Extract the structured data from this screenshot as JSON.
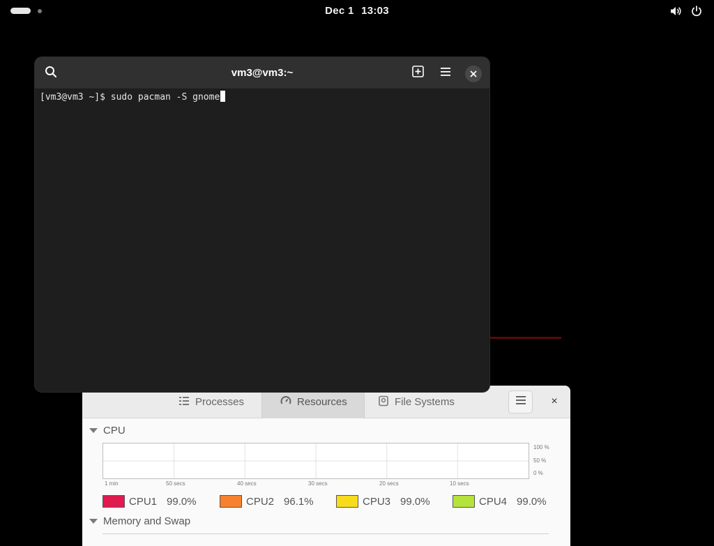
{
  "topbar": {
    "date": "Dec 1",
    "time": "13:03",
    "icons": [
      "activities-indicator",
      "volume-icon",
      "power-icon"
    ]
  },
  "terminal": {
    "title": "vm3@vm3:~",
    "prompt": "[vm3@vm3 ~]$ ",
    "command": "sudo pacman -S gnome",
    "icons": [
      "search-icon",
      "new-tab-icon",
      "hamburger-menu-icon",
      "close-icon"
    ]
  },
  "system_monitor": {
    "tabs": [
      {
        "label": "Processes",
        "icon": "list-icon"
      },
      {
        "label": "Resources",
        "icon": "gauge-icon",
        "active": true
      },
      {
        "label": "File Systems",
        "icon": "disk-icon"
      }
    ],
    "close_label": "×",
    "cpu_section": "CPU",
    "memory_section": "Memory and Swap",
    "y_labels": [
      "100 %",
      "50 %",
      "0 %"
    ],
    "x_labels": [
      "1 min",
      "50 secs",
      "40 secs",
      "30 secs",
      "20 secs",
      "10 secs"
    ],
    "cpus": [
      {
        "name": "CPU1",
        "value": "99.0%",
        "color": "#e01b4f"
      },
      {
        "name": "CPU2",
        "value": "96.1%",
        "color": "#f6812e"
      },
      {
        "name": "CPU3",
        "value": "99.0%",
        "color": "#f9db1e"
      },
      {
        "name": "CPU4",
        "value": "99.0%",
        "color": "#b5e33c"
      }
    ]
  },
  "colors": {
    "desktop_bg": "#000000",
    "terminal_bg": "#1e1e1e",
    "terminal_header": "#303030",
    "accent_red_line": "#5a0a0a"
  }
}
